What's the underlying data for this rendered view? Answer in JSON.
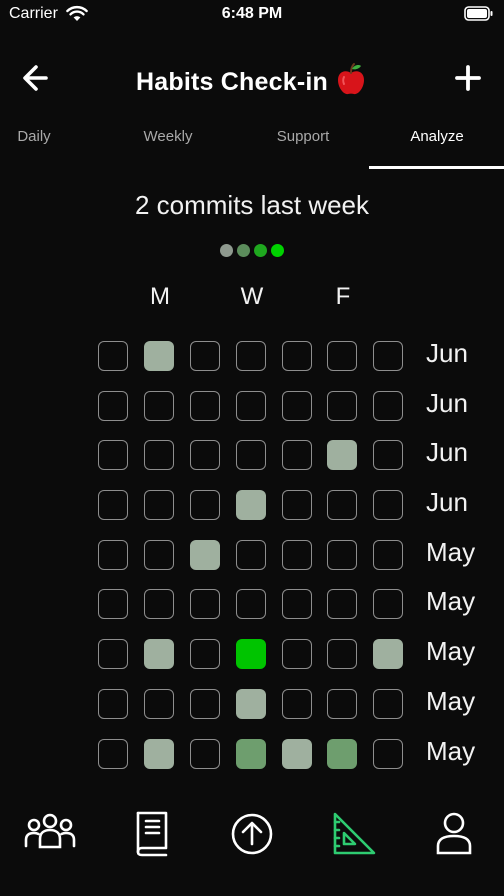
{
  "status": {
    "carrier": "Carrier",
    "time": "6:48 PM"
  },
  "header": {
    "title": "Habits Check-in",
    "back_icon": "arrow-left-icon",
    "add_icon": "plus-icon",
    "title_icon": "apple-icon"
  },
  "tabs": [
    {
      "label": "Daily",
      "active": false
    },
    {
      "label": "Weekly",
      "active": false
    },
    {
      "label": "Support",
      "active": false
    },
    {
      "label": "Analyze",
      "active": true
    }
  ],
  "summary": "2 commits last week",
  "legend_colors": [
    "#8f9a8f",
    "#5c8d5c",
    "#1fa81f",
    "#00d200"
  ],
  "weekday_labels": [
    "M",
    "W",
    "F"
  ],
  "colors": {
    "level1": "#9fb09f",
    "level2": "#6e9e6e",
    "level3": "#00c400",
    "accent": "#2ecc71"
  },
  "calendar": [
    {
      "month": "Jun",
      "levels": [
        0,
        1,
        0,
        0,
        0,
        0,
        0
      ]
    },
    {
      "month": "Jun",
      "levels": [
        0,
        0,
        0,
        0,
        0,
        0,
        0
      ]
    },
    {
      "month": "Jun",
      "levels": [
        0,
        0,
        0,
        0,
        0,
        1,
        0
      ]
    },
    {
      "month": "Jun",
      "levels": [
        0,
        0,
        0,
        1,
        0,
        0,
        0
      ]
    },
    {
      "month": "May",
      "levels": [
        0,
        0,
        1,
        0,
        0,
        0,
        0
      ]
    },
    {
      "month": "May",
      "levels": [
        0,
        0,
        0,
        0,
        0,
        0,
        0
      ]
    },
    {
      "month": "May",
      "levels": [
        0,
        1,
        0,
        3,
        0,
        0,
        1
      ]
    },
    {
      "month": "May",
      "levels": [
        0,
        0,
        0,
        1,
        0,
        0,
        0
      ]
    },
    {
      "month": "May",
      "levels": [
        0,
        1,
        0,
        2,
        1,
        2,
        0
      ]
    }
  ],
  "bottom_tabs": [
    {
      "icon": "group-icon",
      "active": false
    },
    {
      "icon": "book-icon",
      "active": false
    },
    {
      "icon": "upload-circle-icon",
      "active": false
    },
    {
      "icon": "triangle-ruler-icon",
      "active": true
    },
    {
      "icon": "user-icon",
      "active": false
    }
  ]
}
